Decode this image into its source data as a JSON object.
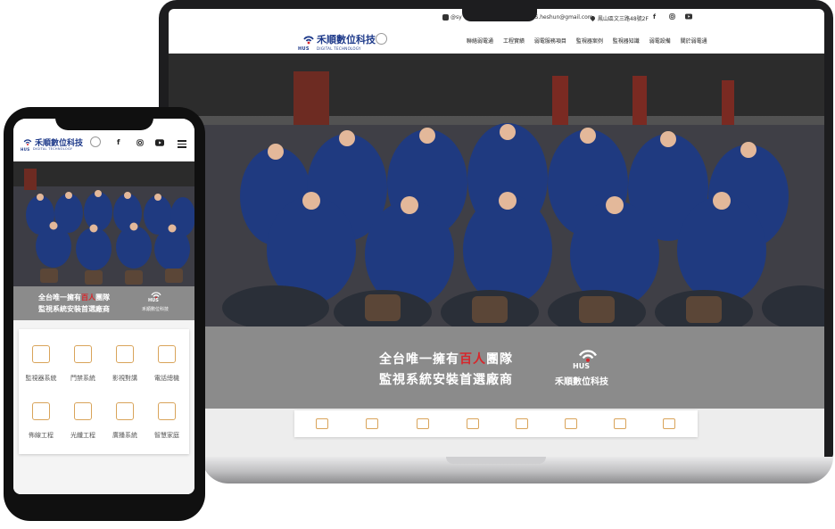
{
  "desktop": {
    "topbar": {
      "line_id": "@sy",
      "email": "HS.heshun@gmail.com",
      "address": "鳳山區文三路48號2F"
    },
    "logo": {
      "name": "禾順數位科技",
      "abbr": "HUS",
      "tagline": "DIGITAL TECHNOLOGY"
    },
    "nav": [
      "聯絡弱電通",
      "工程實績",
      "弱電服務項目",
      "監視器案例",
      "監視器知識",
      "弱電設備",
      "關於弱電通"
    ],
    "banner": {
      "line1_pre": "全台唯一擁有",
      "line1_highlight": "百人",
      "line1_post": "團隊",
      "line2": "監視系統安裝首選廠商",
      "logo_abbr": "HUS",
      "logo_name": "禾順數位科技"
    }
  },
  "mobile": {
    "logo": {
      "name": "禾順數位科技",
      "abbr": "HUS",
      "tagline": "DIGITAL TECHNOLOGY"
    },
    "banner": {
      "line1_pre": "全台唯一擁有",
      "line1_highlight": "百人",
      "line1_post": "團隊",
      "line2": "監視系統安裝首選廠商",
      "logo_abbr": "HUS",
      "logo_name": "禾順數位科技"
    },
    "services": [
      {
        "label": "監視器系統",
        "icon": "cctv-camera-icon"
      },
      {
        "label": "門禁系統",
        "icon": "access-keypad-icon"
      },
      {
        "label": "影視對講",
        "icon": "intercom-icon"
      },
      {
        "label": "電話總機",
        "icon": "phone-switchboard-icon"
      },
      {
        "label": "佈線工程",
        "icon": "network-cabling-icon"
      },
      {
        "label": "光纖工程",
        "icon": "fiber-switch-icon"
      },
      {
        "label": "廣播系統",
        "icon": "megaphone-icon"
      },
      {
        "label": "智慧家庭",
        "icon": "smart-home-icon"
      }
    ]
  },
  "colors": {
    "brand_blue": "#1e3a8a",
    "accent_gold": "#d9a45a",
    "highlight_red": "#d7262b",
    "banner_gray": "#8b8b8b"
  }
}
